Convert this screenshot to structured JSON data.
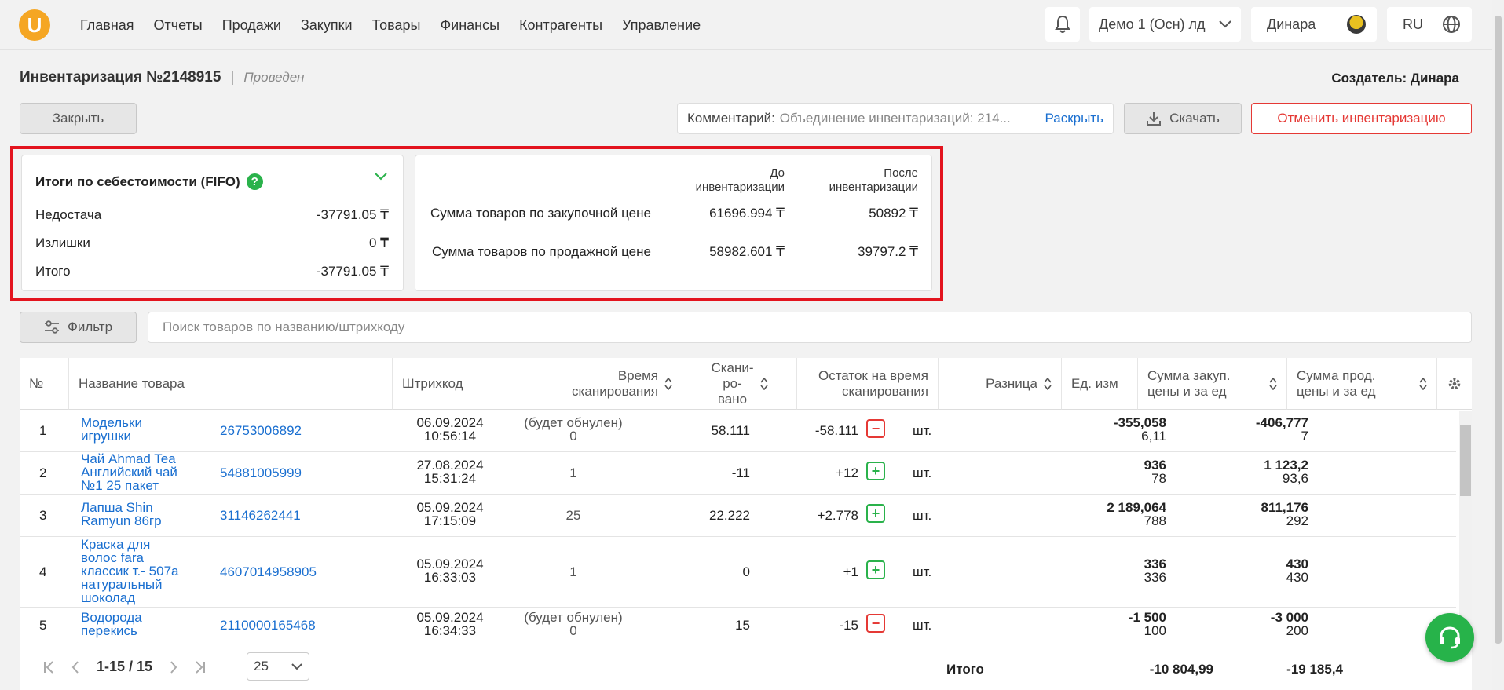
{
  "nav": {
    "logo": "U",
    "menu": [
      "Главная",
      "Отчеты",
      "Продажи",
      "Закупки",
      "Товары",
      "Финансы",
      "Контрагенты",
      "Управление"
    ],
    "org": "Демо 1 (Осн) лд",
    "user": "Динара",
    "lang": "RU"
  },
  "header": {
    "title": "Инвентаризация №2148915",
    "separator": "|",
    "status": "Проведен",
    "creator_label": "Создатель:",
    "creator_name": "Динара"
  },
  "actions": {
    "close": "Закрыть",
    "comment_label": "Комментарий:",
    "comment_value": "Объединение инвентаризаций: 214...",
    "expand": "Раскрыть",
    "download": "Скачать",
    "cancel": "Отменить инвентаризацию"
  },
  "summary": {
    "title": "Итоги по себестоимости (FIFO)",
    "help": "?",
    "rows": [
      {
        "label": "Недостача",
        "value": "-37791.05 ₸"
      },
      {
        "label": "Излишки",
        "value": "0 ₸"
      },
      {
        "label": "Итого",
        "value": "-37791.05 ₸"
      }
    ]
  },
  "compare": {
    "before_header": [
      "До",
      "инвентаризации"
    ],
    "after_header": [
      "После",
      "инвентаризации"
    ],
    "rows": [
      {
        "label": "Сумма товаров по закупочной цене",
        "before": "61696.994 ₸",
        "after": "50892 ₸"
      },
      {
        "label": "Сумма товаров по продажной цене",
        "before": "58982.601 ₸",
        "after": "39797.2 ₸"
      }
    ]
  },
  "filter": {
    "button": "Фильтр",
    "search_placeholder": "Поиск товаров по названию/штрихкоду"
  },
  "table": {
    "headers": {
      "num": "№",
      "name": "Название товара",
      "barcode": "Штрихкод",
      "scan_time": [
        "Время",
        "сканирования"
      ],
      "scanned": [
        "Скани-",
        "ро-",
        "вано"
      ],
      "remainder": [
        "Остаток на время",
        "сканирования"
      ],
      "diff": "Разница",
      "unit": "Ед. изм",
      "buy": [
        "Сумма закуп.",
        "цены и за ед"
      ],
      "sell": [
        "Сумма прод.",
        "цены и за ед"
      ]
    },
    "rows": [
      {
        "num": "1",
        "name": [
          "Модельки",
          "игрушки"
        ],
        "barcode": "26753006892",
        "date": "06.09.2024",
        "time": "10:56:14",
        "scan1": "(будет обнулен)",
        "scan2": "0",
        "scanned": "58.111",
        "diff": "-58.111",
        "diff_sign": "−",
        "unit": "шт.",
        "buy_total": "-355,058",
        "buy_unit": "6,11",
        "sell_total": "-406,777",
        "sell_unit": "7"
      },
      {
        "num": "2",
        "name": [
          "Чай Ahmad Tea",
          "Английский чай",
          "№1 25 пакет"
        ],
        "barcode": "54881005999",
        "date": "27.08.2024",
        "time": "15:31:24",
        "scan1": "1",
        "scan2": "",
        "scanned": "-11",
        "diff": "+12",
        "diff_sign": "+",
        "unit": "шт.",
        "buy_total": "936",
        "buy_unit": "78",
        "sell_total": "1 123,2",
        "sell_unit": "93,6"
      },
      {
        "num": "3",
        "name": [
          "Лапша Shin",
          "Ramyun 86гр"
        ],
        "barcode": "31146262441",
        "date": "05.09.2024",
        "time": "17:15:09",
        "scan1": "25",
        "scan2": "",
        "scanned": "22.222",
        "diff": "+2.778",
        "diff_sign": "+",
        "unit": "шт.",
        "buy_total": "2 189,064",
        "buy_unit": "788",
        "sell_total": "811,176",
        "sell_unit": "292"
      },
      {
        "num": "4",
        "name": [
          "Краска для",
          "волос fara",
          "классик т.- 507а",
          "натуральный",
          "шоколад"
        ],
        "barcode": "4607014958905",
        "date": "05.09.2024",
        "time": "16:33:03",
        "scan1": "1",
        "scan2": "",
        "scanned": "0",
        "diff": "+1",
        "diff_sign": "+",
        "unit": "шт.",
        "buy_total": "336",
        "buy_unit": "336",
        "sell_total": "430",
        "sell_unit": "430"
      },
      {
        "num": "5",
        "name": [
          "Водорода",
          "перекись"
        ],
        "barcode": "2110000165468",
        "date": "05.09.2024",
        "time": "16:34:33",
        "scan1": "(будет обнулен)",
        "scan2": "0",
        "scanned": "15",
        "diff": "-15",
        "diff_sign": "−",
        "unit": "шт.",
        "buy_total": "-1 500",
        "buy_unit": "100",
        "sell_total": "-3 000",
        "sell_unit": "200"
      }
    ],
    "footer": {
      "range": "1-15 / 15",
      "page_size": "25",
      "total_label": "Итого",
      "total_buy": "-10 804,99",
      "total_sell": "-19 185,4"
    }
  },
  "colors": {
    "accent": "#1a6fd0",
    "danger": "#e53935",
    "success": "#2ab24b",
    "highlight": "#e3141e",
    "logo": "#f5a623"
  }
}
